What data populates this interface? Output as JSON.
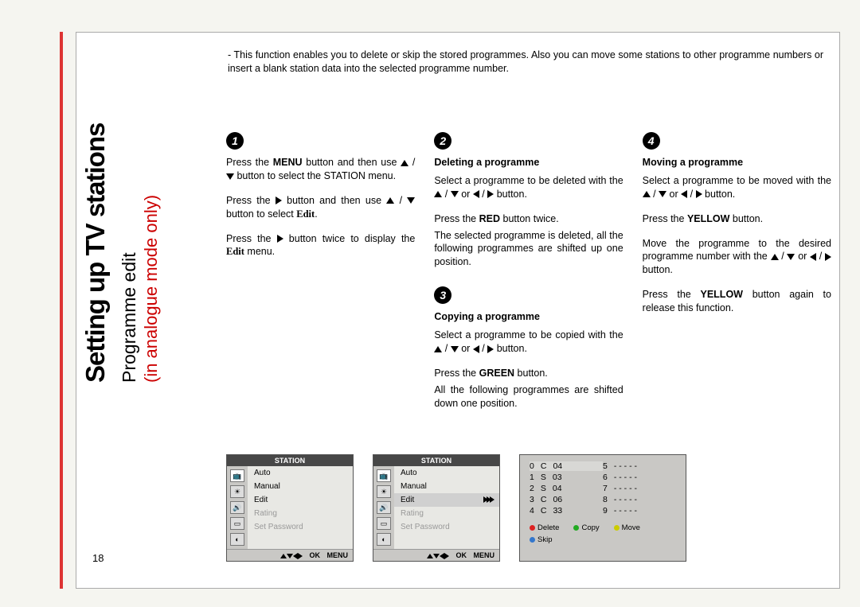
{
  "side": {
    "title": "Setting up TV stations",
    "subtitle": "Programme edit",
    "note": "(in analogue mode only)"
  },
  "intro_prefix": "- ",
  "intro": "This function enables you to delete or skip the stored programmes. Also you can move some stations to other programme numbers or insert a blank station data into the selected programme number.",
  "steps": {
    "s1": {
      "num": "1",
      "p1_a": "Press the ",
      "p1_b": "MENU",
      "p1_c": " button and then use ",
      "p1_d": " / ",
      "p1_e": " button to select the STATION menu.",
      "p2_a": "Press the ",
      "p2_b": " button and then use ",
      "p2_c": " / ",
      "p2_d": " button to select ",
      "p2_e": "Edit",
      "p2_f": ".",
      "p3_a": "Press the ",
      "p3_b": " button twice to display the ",
      "p3_c": "Edit",
      "p3_d": " menu."
    },
    "s2": {
      "num": "2",
      "h": "Deleting a programme",
      "p1": "Select a programme to be deleted with the ",
      "p1b": " / ",
      "p1c": " or ",
      "p1d": " / ",
      "p1e": " button.",
      "p2a": "Press the ",
      "p2b": "RED",
      "p2c": " button twice.",
      "p3": "The selected programme is deleted, all the following programmes are shifted up one position."
    },
    "s3": {
      "num": "3",
      "h": "Copying a programme",
      "p1": "Select a programme to be copied with the ",
      "p1b": " / ",
      "p1c": " or ",
      "p1d": " / ",
      "p1e": " button.",
      "p2a": "Press the ",
      "p2b": "GREEN",
      "p2c": " button.",
      "p3": "All the following programmes are shifted down one position."
    },
    "s4": {
      "num": "4",
      "h": "Moving a programme",
      "p1": "Select a programme to be moved with the ",
      "p1b": " / ",
      "p1c": " or ",
      "p1d": " / ",
      "p1e": " button.",
      "p2a": "Press the ",
      "p2b": "YELLOW",
      "p2c": " button.",
      "p3": "Move the programme to the desired programme number with the ",
      "p3b": " / ",
      "p3c": " or ",
      "p3d": " / ",
      "p3e": " button.",
      "p4a": "Press the ",
      "p4b": "YELLOW",
      "p4c": " button again to release this function."
    }
  },
  "osd": {
    "header": "STATION",
    "items": [
      "Auto",
      "Manual",
      "Edit",
      "Rating",
      "Set Password"
    ],
    "greyed": [
      "Rating",
      "Set Password"
    ],
    "footer_ok": "OK",
    "footer_menu": "MENU"
  },
  "proglist": {
    "left": [
      {
        "n": "0",
        "t": "C",
        "c": "04"
      },
      {
        "n": "1",
        "t": "S",
        "c": "03"
      },
      {
        "n": "2",
        "t": "S",
        "c": "04"
      },
      {
        "n": "3",
        "t": "C",
        "c": "06"
      },
      {
        "n": "4",
        "t": "C",
        "c": "33"
      }
    ],
    "right": [
      {
        "n": "5",
        "t": "",
        "c": "- - - - -"
      },
      {
        "n": "6",
        "t": "",
        "c": "- - - - -"
      },
      {
        "n": "7",
        "t": "",
        "c": "- - - - -"
      },
      {
        "n": "8",
        "t": "",
        "c": "- - - - -"
      },
      {
        "n": "9",
        "t": "",
        "c": "- - - - -"
      }
    ],
    "legend": {
      "del": "Delete",
      "copy": "Copy",
      "move": "Move",
      "skip": "Skip"
    }
  },
  "page_number": "18"
}
